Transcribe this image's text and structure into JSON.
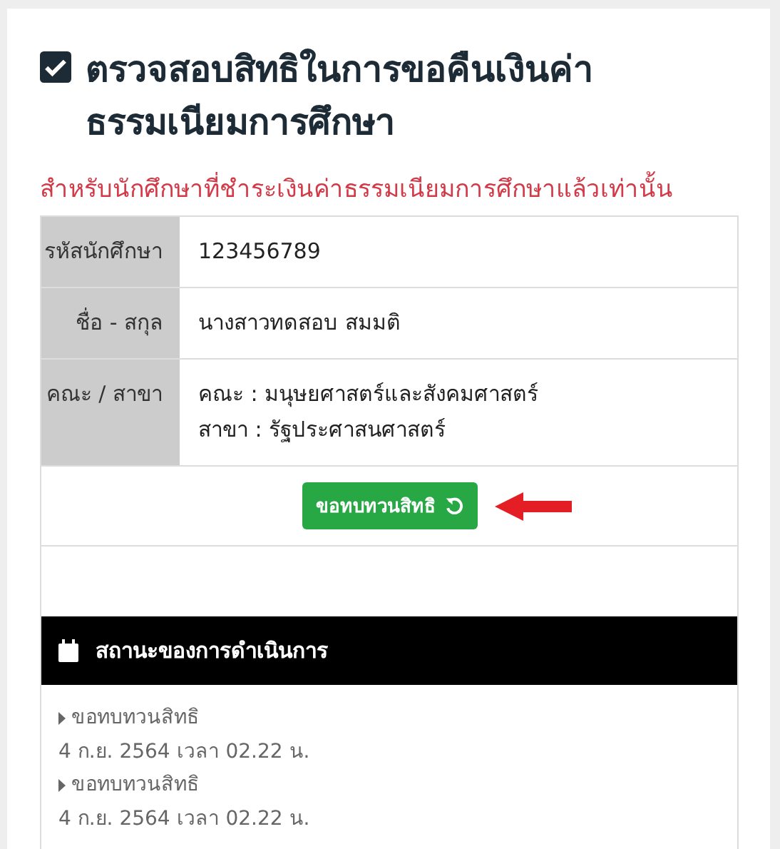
{
  "title": "ตรวจสอบสิทธิในการขอคืนเงินค่าธรรมเนียมการศึกษา",
  "notice": "สำหรับนักศึกษาที่ชำระเงินค่าธรรมเนียมการศึกษาแล้วเท่านั้น",
  "info_rows": [
    {
      "label": "รหัสนักศึกษา",
      "values": [
        "123456789"
      ]
    },
    {
      "label": "ชื่อ - สกุล",
      "values": [
        "นางสาวทดสอบ สมมติ"
      ]
    },
    {
      "label": "คณะ / สาขา",
      "values": [
        "คณะ : มนุษยศาสตร์และสังคมศาสตร์",
        "สาขา : รัฐประศาสนศาสตร์"
      ]
    }
  ],
  "review_button": {
    "label": "ขอทบทวนสิทธิ"
  },
  "status_panel": {
    "title": "สถานะของการดำเนินการ",
    "items": [
      {
        "action": "ขอทบทวนสิทธิ",
        "time": "4 ก.ย. 2564 เวลา 02.22 น."
      },
      {
        "action": "ขอทบทวนสิทธิ",
        "time": "4 ก.ย. 2564 เวลา 02.22 น."
      }
    ]
  }
}
